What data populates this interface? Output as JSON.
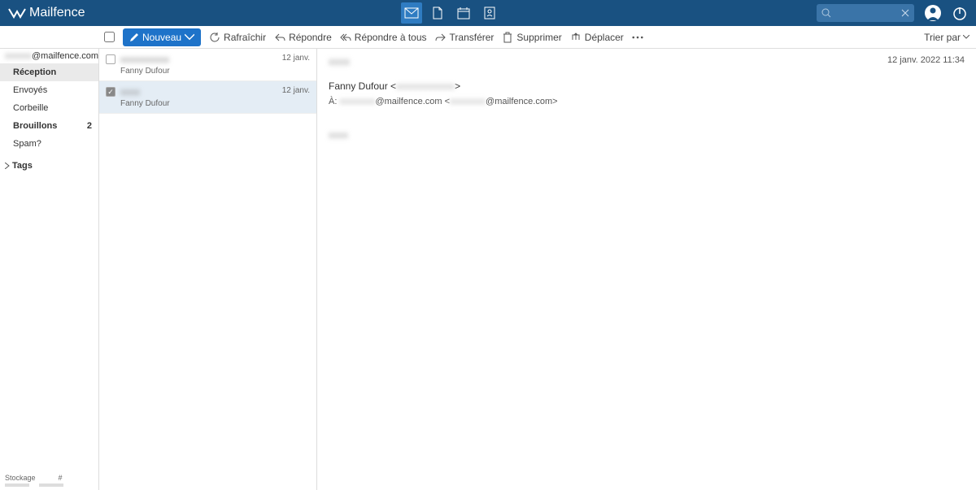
{
  "brand": "Mailfence",
  "toolbar": {
    "new_label": "Nouveau",
    "refresh": "Rafraîchir",
    "reply": "Répondre",
    "reply_all": "Répondre à tous",
    "forward": "Transférer",
    "delete": "Supprimer",
    "move": "Déplacer",
    "sort_label": "Trier par"
  },
  "sidebar": {
    "account_visible": "@mailfence.com",
    "account_hidden": "xxxxxx",
    "folders": [
      {
        "label": "Réception",
        "active": true
      },
      {
        "label": "Envoyés"
      },
      {
        "label": "Corbeille"
      },
      {
        "label": "Brouillons",
        "count": "2",
        "bold": true
      },
      {
        "label": "Spam?"
      }
    ],
    "tags_label": "Tags",
    "storage_label": "Stockage",
    "storage_hash": "#"
  },
  "list": [
    {
      "subject_hidden": "xxxxxxxxxx",
      "date": "12 janv.",
      "from": "Fanny Dufour",
      "checked": false,
      "selected": false
    },
    {
      "subject_hidden": "xxxx",
      "date": "12 janv.",
      "from": "Fanny Dufour",
      "checked": true,
      "selected": true
    }
  ],
  "reader": {
    "subject_hidden": "xxxx",
    "datetime": "12 janv. 2022 11:34",
    "from_name": "Fanny Dufour",
    "from_email_hidden": "xxxxxxxxxxxx",
    "to_label": "À:",
    "to_hidden1": "xxxxxxxx",
    "to_visible1": "@mailfence.com <",
    "to_hidden2": "xxxxxxxx",
    "to_visible2": "@mailfence.com>",
    "body_hidden": "xxxx"
  }
}
